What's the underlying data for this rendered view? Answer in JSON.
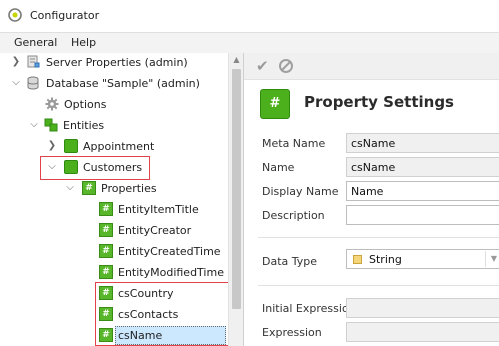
{
  "window": {
    "title": "Configurator"
  },
  "menu": {
    "items": [
      "General",
      "Help"
    ]
  },
  "tree": {
    "items": [
      {
        "label": "Server Properties (admin)",
        "expander": "collapsed"
      },
      {
        "label": "Database \"Sample\" (admin)",
        "expander": "expanded"
      },
      {
        "label": "Options",
        "expander": "none"
      },
      {
        "label": "Entities",
        "expander": "expanded"
      },
      {
        "label": "Appointment",
        "expander": "collapsed"
      },
      {
        "label": "Customers",
        "expander": "expanded"
      },
      {
        "label": "Properties",
        "expander": "expanded"
      },
      {
        "label": "EntityItemTitle",
        "expander": "none"
      },
      {
        "label": "EntityCreator",
        "expander": "none"
      },
      {
        "label": "EntityCreatedTime",
        "expander": "none"
      },
      {
        "label": "EntityModifiedTime",
        "expander": "none"
      },
      {
        "label": "csCountry",
        "expander": "none"
      },
      {
        "label": "csContacts",
        "expander": "none"
      },
      {
        "label": "csName",
        "expander": "none",
        "selected": true
      }
    ]
  },
  "toolbar": {
    "check_icon": "check-icon",
    "cancel_icon": "cancel-icon"
  },
  "property_settings": {
    "title": "Property Settings",
    "icon_glyph": "#",
    "fields": {
      "meta_name": {
        "label": "Meta Name",
        "value": "csName"
      },
      "name": {
        "label": "Name",
        "value": "csName"
      },
      "display_name": {
        "label": "Display Name",
        "value": "Name"
      },
      "description": {
        "label": "Description",
        "value": ""
      },
      "data_type": {
        "label": "Data Type",
        "value": "String"
      },
      "initial_expression": {
        "label": "Initial Expression",
        "value": ""
      },
      "expression": {
        "label": "Expression",
        "value": ""
      }
    }
  },
  "colors": {
    "accent_green": "#4caf1c",
    "highlight_red": "#e0434a",
    "selection_blue": "#cce8ff"
  }
}
